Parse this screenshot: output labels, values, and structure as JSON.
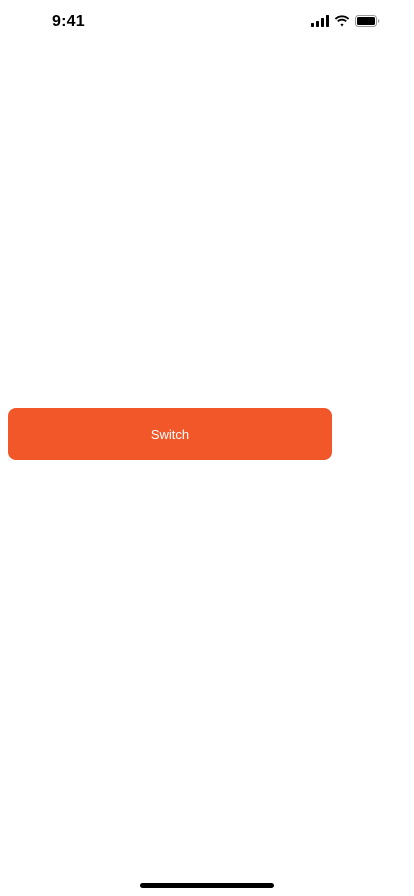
{
  "status_bar": {
    "time": "9:41",
    "icons": [
      "cellular-signal-icon",
      "wifi-icon",
      "battery-icon"
    ]
  },
  "main": {
    "switch_button_label": "Switch",
    "accent_color": "#F2572A"
  }
}
